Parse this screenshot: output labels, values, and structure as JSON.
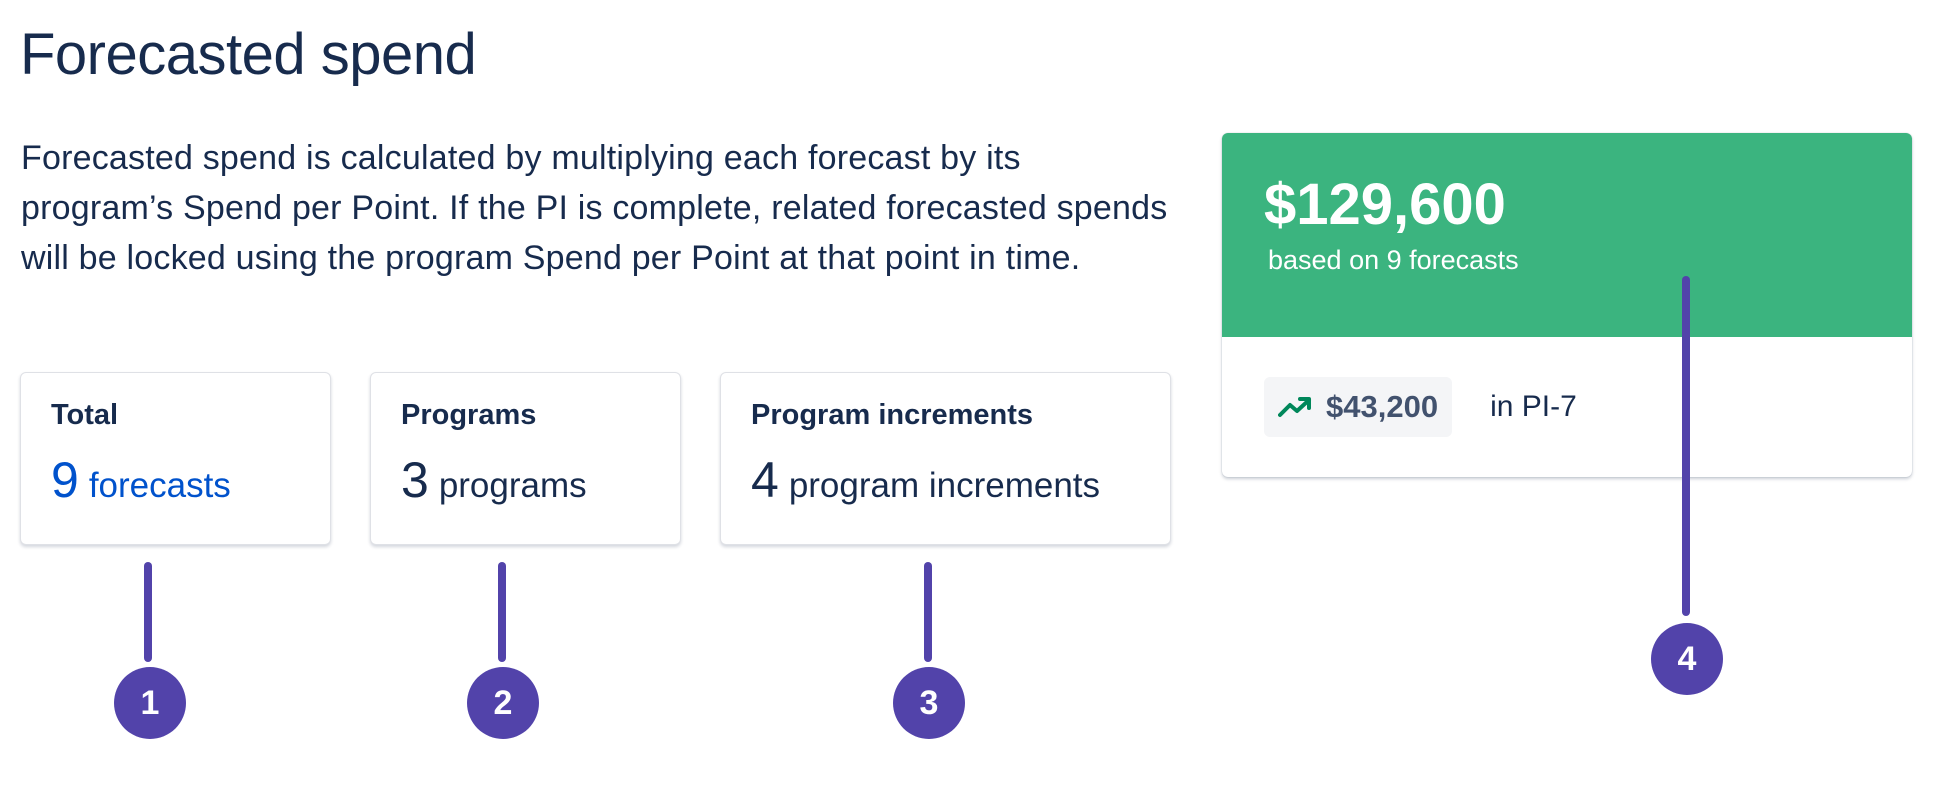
{
  "header": {
    "title": "Forecasted spend"
  },
  "description": "Forecasted spend is calculated by multiplying each forecast by its program’s Spend per Point. If the PI is complete, related forecasted spends will be locked using the program Spend per Point at that point in time.",
  "stats": {
    "total": {
      "label": "Total",
      "value": "9",
      "unit": "forecasts"
    },
    "programs": {
      "label": "Programs",
      "value": "3",
      "unit": "programs"
    },
    "increments": {
      "label": "Program increments",
      "value": "4",
      "unit": "program increments"
    }
  },
  "summary": {
    "amount": "$129,600",
    "subtitle": "based on 9 forecasts",
    "trend_icon": "trending-up-icon",
    "trend_value": "$43,200",
    "trend_context": "in PI-7"
  },
  "callouts": [
    "1",
    "2",
    "3",
    "4"
  ],
  "colors": {
    "accent_green": "#3bb47f",
    "callout_purple": "#5243aa",
    "link_blue": "#0052cc",
    "text_dark": "#172b4d",
    "trend_green": "#00875a"
  }
}
